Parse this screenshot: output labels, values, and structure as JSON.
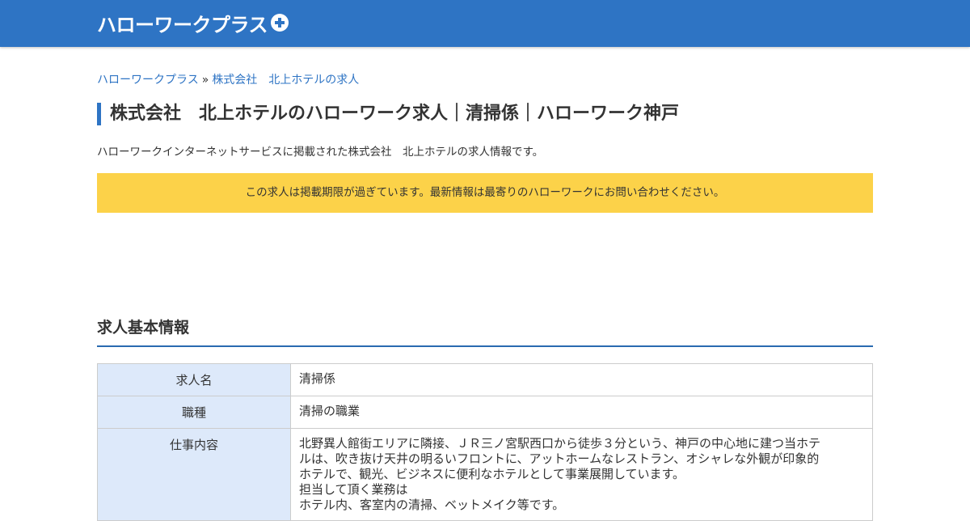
{
  "header": {
    "logo_text": "ハローワークプラス",
    "logo_icon": "plus-circle-icon",
    "bar_color": "#2e74c4"
  },
  "breadcrumb": {
    "home": "ハローワークプラス",
    "separator": "»",
    "current": "株式会社　北上ホテルの求人"
  },
  "page": {
    "title": "株式会社　北上ホテルのハローワーク求人｜清掃係｜ハローワーク神戸",
    "intro": "ハローワークインターネットサービスに掲載された株式会社　北上ホテルの求人情報です。",
    "notice": "この求人は掲載期限が過ぎています。最新情報は最寄りのハローワークにお問い合わせください。",
    "notice_color": "#fcd249"
  },
  "section": {
    "title": "求人基本情報"
  },
  "table": {
    "rows": [
      {
        "label": "求人名",
        "value": "清掃係"
      },
      {
        "label": "職種",
        "value": "清掃の職業"
      },
      {
        "label": "仕事内容",
        "lines": [
          "北野異人館街エリアに隣接、ＪＲ三ノ宮駅西口から徒歩３分という、神戸の中心地に建つ当ホテ",
          "ルは、吹き抜け天井の明るいフロントに、アットホームなレストラン、オシャレな外観が印象的",
          "ホテルで、観光、ビジネスに便利なホテルとして事業展開しています。",
          "担当して頂く業務は",
          "ホテル内、客室内の清掃、ベットメイク等です。"
        ]
      }
    ]
  }
}
